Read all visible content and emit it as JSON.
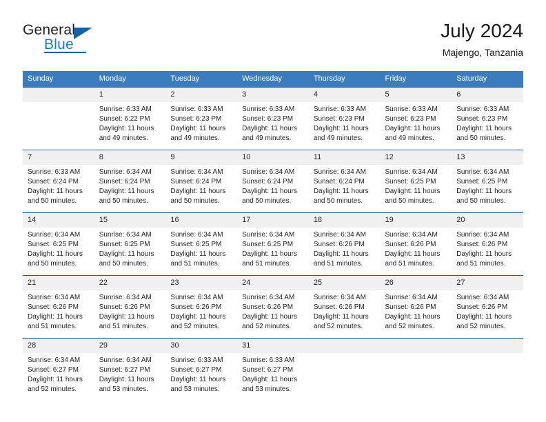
{
  "brand": {
    "name_part1": "General",
    "name_part2": "Blue",
    "logo_icon": "triangle-flag-icon"
  },
  "header": {
    "title": "July 2024",
    "subtitle": "Majengo, Tanzania"
  },
  "calendar": {
    "weekday_headers": [
      "Sunday",
      "Monday",
      "Tuesday",
      "Wednesday",
      "Thursday",
      "Friday",
      "Saturday"
    ],
    "colors": {
      "header_background": "#3a7cbe",
      "header_text": "#ffffff",
      "row_rule": "#1461a5",
      "daynum_background": "#f0f0f0",
      "brand_blue": "#1f7bc1",
      "text": "#222222"
    },
    "weeks": [
      [
        {
          "day": "",
          "lines": []
        },
        {
          "day": "1",
          "lines": [
            "Sunrise: 6:33 AM",
            "Sunset: 6:22 PM",
            "Daylight: 11 hours",
            "and 49 minutes."
          ]
        },
        {
          "day": "2",
          "lines": [
            "Sunrise: 6:33 AM",
            "Sunset: 6:23 PM",
            "Daylight: 11 hours",
            "and 49 minutes."
          ]
        },
        {
          "day": "3",
          "lines": [
            "Sunrise: 6:33 AM",
            "Sunset: 6:23 PM",
            "Daylight: 11 hours",
            "and 49 minutes."
          ]
        },
        {
          "day": "4",
          "lines": [
            "Sunrise: 6:33 AM",
            "Sunset: 6:23 PM",
            "Daylight: 11 hours",
            "and 49 minutes."
          ]
        },
        {
          "day": "5",
          "lines": [
            "Sunrise: 6:33 AM",
            "Sunset: 6:23 PM",
            "Daylight: 11 hours",
            "and 49 minutes."
          ]
        },
        {
          "day": "6",
          "lines": [
            "Sunrise: 6:33 AM",
            "Sunset: 6:23 PM",
            "Daylight: 11 hours",
            "and 50 minutes."
          ]
        }
      ],
      [
        {
          "day": "7",
          "lines": [
            "Sunrise: 6:33 AM",
            "Sunset: 6:24 PM",
            "Daylight: 11 hours",
            "and 50 minutes."
          ]
        },
        {
          "day": "8",
          "lines": [
            "Sunrise: 6:34 AM",
            "Sunset: 6:24 PM",
            "Daylight: 11 hours",
            "and 50 minutes."
          ]
        },
        {
          "day": "9",
          "lines": [
            "Sunrise: 6:34 AM",
            "Sunset: 6:24 PM",
            "Daylight: 11 hours",
            "and 50 minutes."
          ]
        },
        {
          "day": "10",
          "lines": [
            "Sunrise: 6:34 AM",
            "Sunset: 6:24 PM",
            "Daylight: 11 hours",
            "and 50 minutes."
          ]
        },
        {
          "day": "11",
          "lines": [
            "Sunrise: 6:34 AM",
            "Sunset: 6:24 PM",
            "Daylight: 11 hours",
            "and 50 minutes."
          ]
        },
        {
          "day": "12",
          "lines": [
            "Sunrise: 6:34 AM",
            "Sunset: 6:25 PM",
            "Daylight: 11 hours",
            "and 50 minutes."
          ]
        },
        {
          "day": "13",
          "lines": [
            "Sunrise: 6:34 AM",
            "Sunset: 6:25 PM",
            "Daylight: 11 hours",
            "and 50 minutes."
          ]
        }
      ],
      [
        {
          "day": "14",
          "lines": [
            "Sunrise: 6:34 AM",
            "Sunset: 6:25 PM",
            "Daylight: 11 hours",
            "and 50 minutes."
          ]
        },
        {
          "day": "15",
          "lines": [
            "Sunrise: 6:34 AM",
            "Sunset: 6:25 PM",
            "Daylight: 11 hours",
            "and 50 minutes."
          ]
        },
        {
          "day": "16",
          "lines": [
            "Sunrise: 6:34 AM",
            "Sunset: 6:25 PM",
            "Daylight: 11 hours",
            "and 51 minutes."
          ]
        },
        {
          "day": "17",
          "lines": [
            "Sunrise: 6:34 AM",
            "Sunset: 6:25 PM",
            "Daylight: 11 hours",
            "and 51 minutes."
          ]
        },
        {
          "day": "18",
          "lines": [
            "Sunrise: 6:34 AM",
            "Sunset: 6:26 PM",
            "Daylight: 11 hours",
            "and 51 minutes."
          ]
        },
        {
          "day": "19",
          "lines": [
            "Sunrise: 6:34 AM",
            "Sunset: 6:26 PM",
            "Daylight: 11 hours",
            "and 51 minutes."
          ]
        },
        {
          "day": "20",
          "lines": [
            "Sunrise: 6:34 AM",
            "Sunset: 6:26 PM",
            "Daylight: 11 hours",
            "and 51 minutes."
          ]
        }
      ],
      [
        {
          "day": "21",
          "lines": [
            "Sunrise: 6:34 AM",
            "Sunset: 6:26 PM",
            "Daylight: 11 hours",
            "and 51 minutes."
          ]
        },
        {
          "day": "22",
          "lines": [
            "Sunrise: 6:34 AM",
            "Sunset: 6:26 PM",
            "Daylight: 11 hours",
            "and 51 minutes."
          ]
        },
        {
          "day": "23",
          "lines": [
            "Sunrise: 6:34 AM",
            "Sunset: 6:26 PM",
            "Daylight: 11 hours",
            "and 52 minutes."
          ]
        },
        {
          "day": "24",
          "lines": [
            "Sunrise: 6:34 AM",
            "Sunset: 6:26 PM",
            "Daylight: 11 hours",
            "and 52 minutes."
          ]
        },
        {
          "day": "25",
          "lines": [
            "Sunrise: 6:34 AM",
            "Sunset: 6:26 PM",
            "Daylight: 11 hours",
            "and 52 minutes."
          ]
        },
        {
          "day": "26",
          "lines": [
            "Sunrise: 6:34 AM",
            "Sunset: 6:26 PM",
            "Daylight: 11 hours",
            "and 52 minutes."
          ]
        },
        {
          "day": "27",
          "lines": [
            "Sunrise: 6:34 AM",
            "Sunset: 6:26 PM",
            "Daylight: 11 hours",
            "and 52 minutes."
          ]
        }
      ],
      [
        {
          "day": "28",
          "lines": [
            "Sunrise: 6:34 AM",
            "Sunset: 6:27 PM",
            "Daylight: 11 hours",
            "and 52 minutes."
          ]
        },
        {
          "day": "29",
          "lines": [
            "Sunrise: 6:34 AM",
            "Sunset: 6:27 PM",
            "Daylight: 11 hours",
            "and 53 minutes."
          ]
        },
        {
          "day": "30",
          "lines": [
            "Sunrise: 6:33 AM",
            "Sunset: 6:27 PM",
            "Daylight: 11 hours",
            "and 53 minutes."
          ]
        },
        {
          "day": "31",
          "lines": [
            "Sunrise: 6:33 AM",
            "Sunset: 6:27 PM",
            "Daylight: 11 hours",
            "and 53 minutes."
          ]
        },
        {
          "day": "",
          "lines": []
        },
        {
          "day": "",
          "lines": []
        },
        {
          "day": "",
          "lines": []
        }
      ]
    ]
  }
}
